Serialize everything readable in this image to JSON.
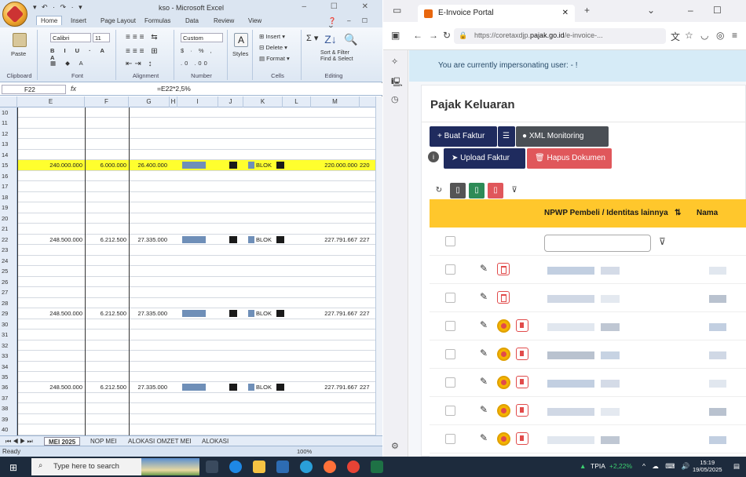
{
  "excel": {
    "title": "kso - Microsoft Excel",
    "qat": "▾ ↶ · ↷ · ▾",
    "tabs": [
      "Home",
      "Insert",
      "Page Layout",
      "Formulas",
      "Data",
      "Review",
      "View"
    ],
    "ribbon": {
      "clipboard_label": "Clipboard",
      "paste": "Paste",
      "font_label": "Font",
      "font_name": "Calibri",
      "font_size": "11",
      "alignment_label": "Alignment",
      "number_label": "Number",
      "number_format": "Custom",
      "styles": "Styles",
      "cells_label": "Cells",
      "insert": "Insert",
      "delete": "Delete",
      "format": "Format",
      "editing_label": "Editing",
      "sort_filter": "Sort & Filter",
      "find_select": "Find & Select"
    },
    "name_box": "F22",
    "fx": "fx",
    "formula": "=E22*2,5%",
    "columns": [
      "E",
      "F",
      "G",
      "H",
      "I",
      "J",
      "K",
      "L",
      "M"
    ],
    "row_numbers": [
      10,
      11,
      12,
      13,
      14,
      15,
      16,
      17,
      18,
      19,
      20,
      21,
      22,
      23,
      24,
      25,
      26,
      27,
      28,
      29,
      30,
      31,
      32,
      33,
      34,
      35,
      36,
      37,
      38,
      39,
      40
    ],
    "data_rows": [
      {
        "row": 15,
        "e": "240.000.000",
        "f": "6.000.000",
        "g": "26.400.000",
        "k": "BLOK",
        "m": "220.000.000",
        "n": "220"
      },
      {
        "row": 22,
        "e": "248.500.000",
        "f": "6.212.500",
        "g": "27.335.000",
        "k": "BLOK",
        "m": "227.791.667",
        "n": "227"
      },
      {
        "row": 29,
        "e": "248.500.000",
        "f": "6.212.500",
        "g": "27.335.000",
        "k": "BLOK",
        "m": "227.791.667",
        "n": "227"
      },
      {
        "row": 36,
        "e": "248.500.000",
        "f": "6.212.500",
        "g": "27.335.000",
        "k": "BLOK",
        "m": "227.791.667",
        "n": "227"
      }
    ],
    "sheet_tabs": [
      "MEI 2025",
      "NOP MEI",
      "ALOKASI OMZET MEI",
      "ALOKASI"
    ],
    "status": "Ready",
    "zoom": "100%"
  },
  "browser": {
    "tab_title": "E-Invoice Portal",
    "url_prefix": "https://coretaxdjp.",
    "url_domain": "pajak.go.id",
    "url_suffix": "/e-invoice-...",
    "alert": "You are currently impersonating user: - !",
    "card_title": "Pajak Keluaran",
    "btn_buat": "+ Buat Faktur",
    "btn_xml": "XML Monitoring",
    "btn_upload": "Upload Faktur",
    "btn_hapus": "Hapus Dokumen",
    "col_npwp": "NPWP Pembeli / Identitas lainnya",
    "col_nama": "Nama",
    "row_icons": [
      "trash",
      "trash",
      "coin",
      "coin",
      "coin",
      "coin",
      "coin",
      "coin"
    ]
  },
  "taskbar": {
    "search_placeholder": "Type here to search",
    "ticker": "TPIA",
    "ticker_change": "+2,22%",
    "time": "15:19",
    "date": "19/05/2025"
  },
  "colors": {
    "highlight_row": "#ffff2e",
    "accent_yellow": "#ffc72c",
    "navy_button": "#1f2b5e",
    "gray_button": "#4a4f55",
    "red_button": "#e0575b",
    "taskbar": "#1d2b3d"
  }
}
